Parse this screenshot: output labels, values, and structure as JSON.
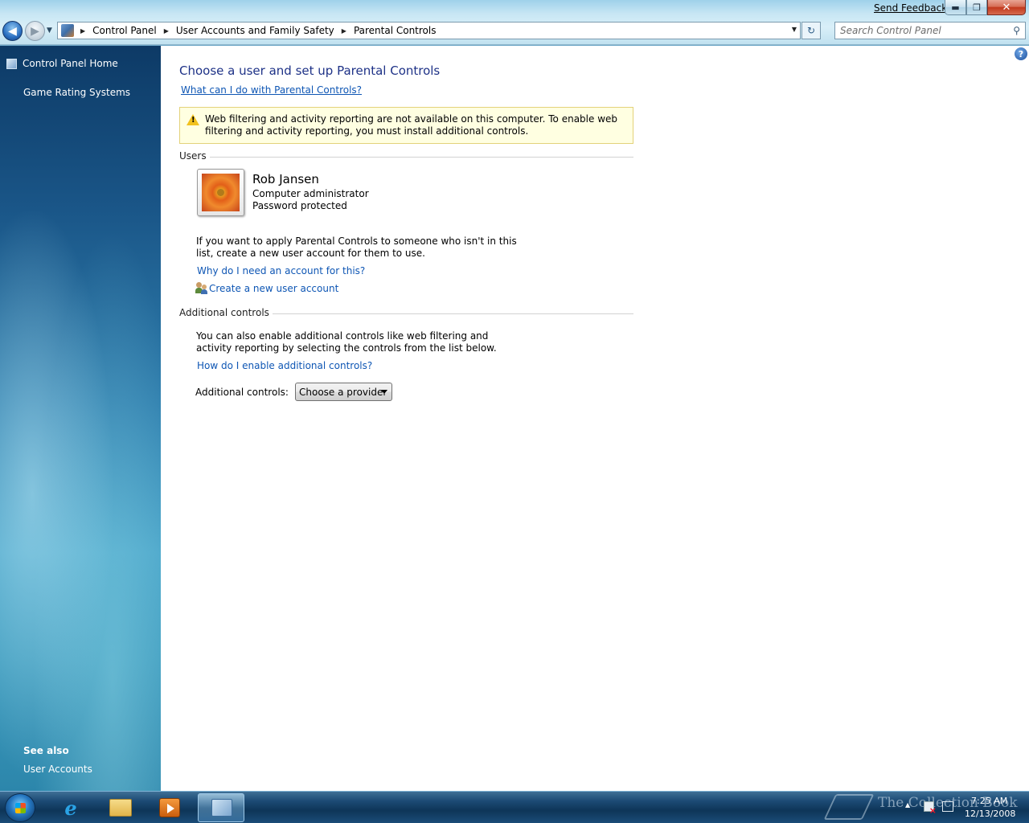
{
  "window": {
    "send_feedback": "Send Feedback",
    "minimize_glyph": "▬",
    "maximize_glyph": "❐",
    "close_glyph": "✕"
  },
  "nav": {
    "back_glyph": "◀",
    "forward_glyph": "▶",
    "recent_glyph": "▼",
    "breadcrumbs": [
      "Control Panel",
      "User Accounts and Family Safety",
      "Parental Controls"
    ],
    "crumb_sep": "▶",
    "refresh_glyph": "↻",
    "search_placeholder": "Search Control Panel",
    "search_glyph": "⚲"
  },
  "sidebar": {
    "home": "Control Panel Home",
    "games": "Game Rating Systems",
    "see_also": "See also",
    "user_accounts": "User Accounts"
  },
  "main": {
    "help_glyph": "?",
    "title": "Choose a user and set up Parental Controls",
    "what_link": "What can I do with Parental Controls?",
    "warning_glyph": "!",
    "warning": "Web filtering and activity reporting are not available on this computer. To enable web filtering and activity reporting, you must install additional controls.",
    "users_heading": "Users",
    "user": {
      "name": "Rob Jansen",
      "role": "Computer administrator",
      "status": "Password protected"
    },
    "apply_text": "If you want to apply Parental Controls to someone who isn't in this list, create a new user account for them to use.",
    "why_link": "Why do I need an account for this?",
    "create_link": "Create a new user account",
    "additional_heading": "Additional controls",
    "additional_text": "You can also enable additional controls like web filtering and activity reporting by selecting the controls from the list below.",
    "how_link": "How do I enable additional controls?",
    "additional_label": "Additional controls:",
    "provider_selected": "Choose a provider"
  },
  "taskbar": {
    "ie_glyph": "e",
    "watermark": "The Collection Book",
    "tray_up_glyph": "▲",
    "time": "7:25 AM",
    "date": "12/13/2008"
  },
  "colors": {
    "title_blue": "#1e3287",
    "link_blue": "#0e56b4",
    "warning_bg": "#ffffe1"
  }
}
